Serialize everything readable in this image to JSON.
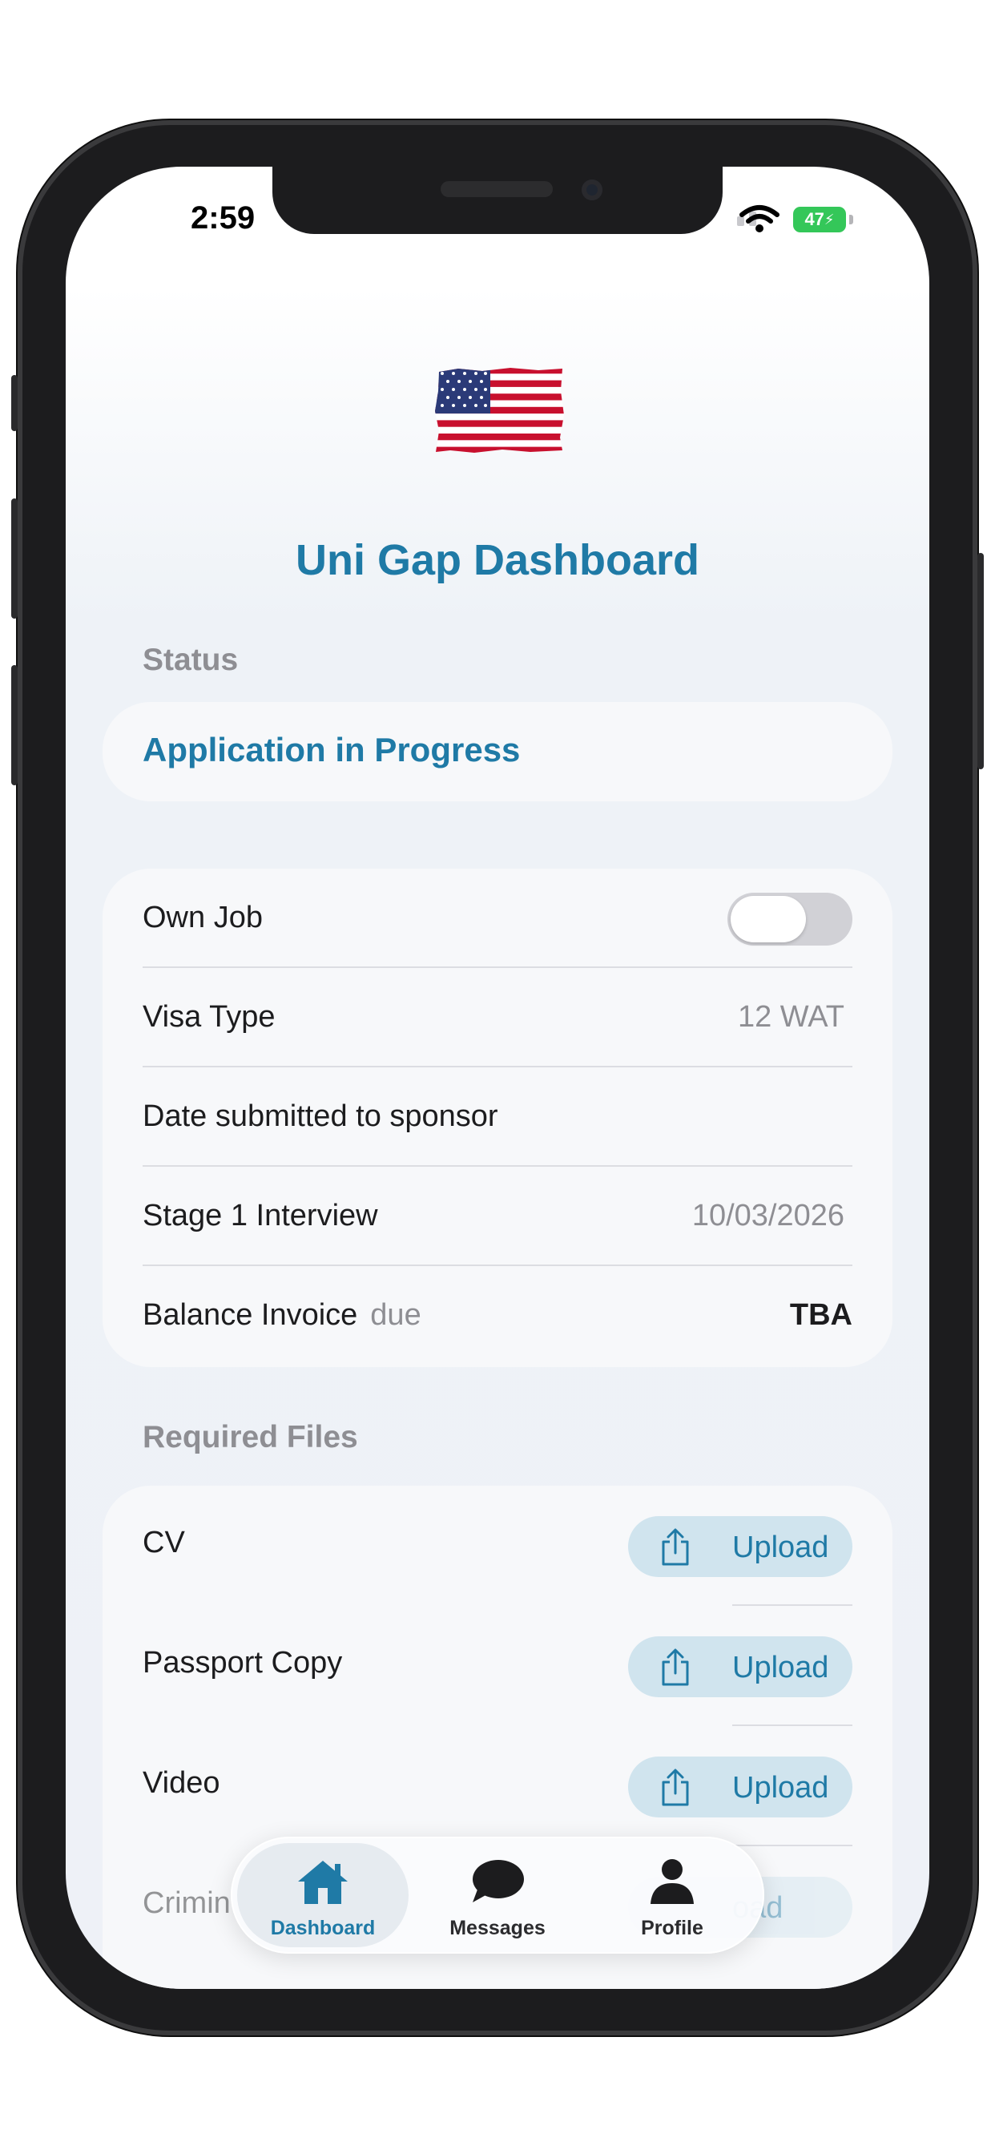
{
  "status_bar": {
    "time": "2:59",
    "battery": "47"
  },
  "header": {
    "flag": "us-flag-icon",
    "title": "Uni Gap Dashboard"
  },
  "status_section": {
    "label": "Status",
    "value": "Application in Progress"
  },
  "details": {
    "own_job": {
      "label": "Own Job",
      "toggle_on": false
    },
    "visa_type": {
      "label": "Visa Type",
      "value": "12 WAT"
    },
    "date_submitted": {
      "label": "Date submitted to sponsor",
      "value": ""
    },
    "stage1_interview": {
      "label": "Stage 1 Interview",
      "value": "10/03/2026"
    },
    "balance_invoice": {
      "label": "Balance Invoice",
      "sub": "due",
      "value": "TBA"
    }
  },
  "required_files": {
    "label": "Required Files",
    "items": [
      {
        "label": "CV",
        "button": "Upload"
      },
      {
        "label": "Passport Copy",
        "button": "Upload"
      },
      {
        "label": "Video",
        "button": "Upload"
      },
      {
        "label": "Crimin",
        "button": "oad"
      }
    ]
  },
  "tabbar": {
    "tabs": [
      {
        "label": "Dashboard",
        "icon": "house-icon",
        "active": true
      },
      {
        "label": "Messages",
        "icon": "message-bubble-icon",
        "active": false
      },
      {
        "label": "Profile",
        "icon": "person-icon",
        "active": false
      }
    ]
  },
  "colors": {
    "accent": "#1f7aa6",
    "upload_bg": "#d0e4ee",
    "battery": "#34c759"
  }
}
